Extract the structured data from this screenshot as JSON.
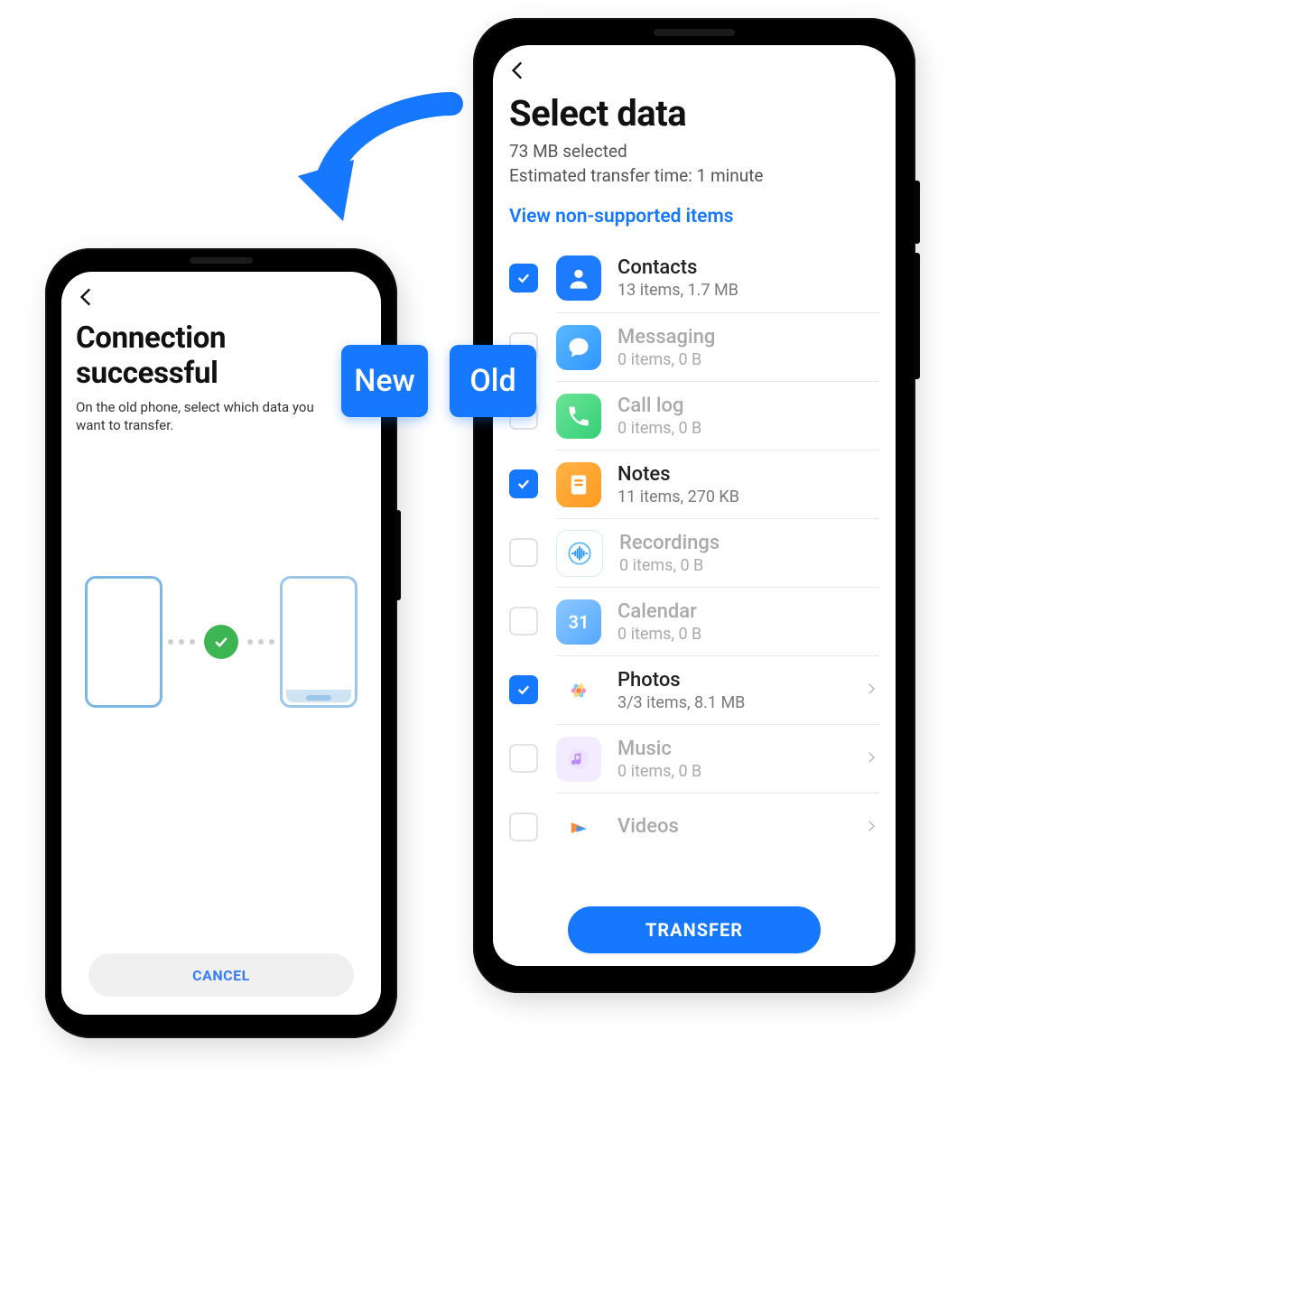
{
  "labels": {
    "new": "New",
    "old": "Old"
  },
  "left_phone": {
    "title": "Connection successful",
    "subtitle": "On the old phone, select which data you want to transfer.",
    "cancel": "CANCEL"
  },
  "right_phone": {
    "title": "Select data",
    "selected_size": "73 MB selected",
    "eta": "Estimated transfer time: 1 minute",
    "link": "View non-supported items",
    "transfer": "TRANSFER",
    "items": [
      {
        "key": "contacts",
        "title": "Contacts",
        "sub": "13 items, 1.7 MB",
        "checked": true,
        "chevron": false,
        "dim": false
      },
      {
        "key": "messaging",
        "title": "Messaging",
        "sub": "0 items, 0 B",
        "checked": false,
        "chevron": false,
        "dim": true
      },
      {
        "key": "calllog",
        "title": "Call log",
        "sub": "0 items, 0 B",
        "checked": false,
        "chevron": false,
        "dim": true
      },
      {
        "key": "notes",
        "title": "Notes",
        "sub": "11 items, 270 KB",
        "checked": true,
        "chevron": false,
        "dim": false
      },
      {
        "key": "recordings",
        "title": "Recordings",
        "sub": "0 items, 0 B",
        "checked": false,
        "chevron": false,
        "dim": true
      },
      {
        "key": "calendar",
        "title": "Calendar",
        "sub": "0 items, 0 B",
        "checked": false,
        "chevron": false,
        "dim": true
      },
      {
        "key": "photos",
        "title": "Photos",
        "sub": "3/3 items, 8.1 MB",
        "checked": true,
        "chevron": true,
        "dim": false
      },
      {
        "key": "music",
        "title": "Music",
        "sub": "0 items, 0 B",
        "checked": false,
        "chevron": true,
        "dim": true
      },
      {
        "key": "videos",
        "title": "Videos",
        "sub": "",
        "checked": false,
        "chevron": true,
        "dim": true
      }
    ]
  }
}
